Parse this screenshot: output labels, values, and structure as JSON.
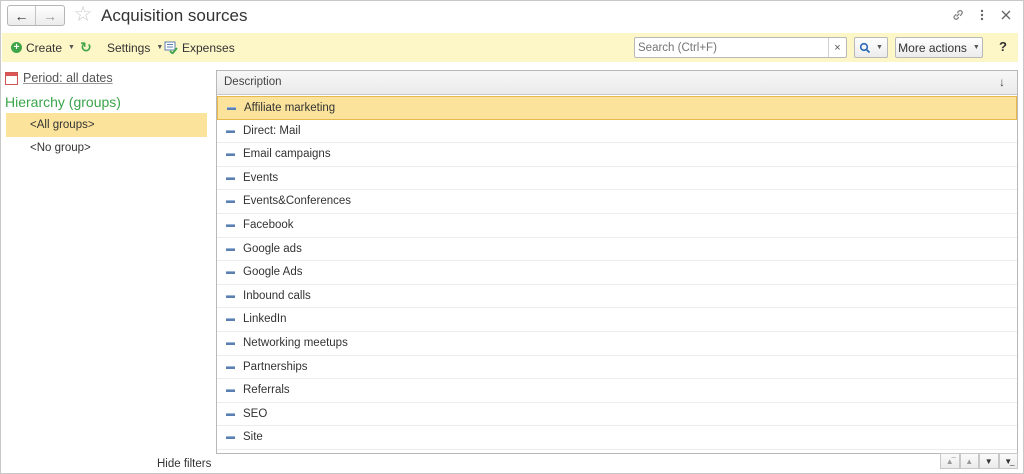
{
  "window": {
    "title": "Acquisition sources"
  },
  "titlebar": {
    "back_icon": "arrow-left-icon",
    "forward_icon": "arrow-right-icon",
    "favorite_icon": "star-icon",
    "link_icon": "link-icon",
    "menu_icon": "kebab-menu-icon",
    "close_icon": "close-icon"
  },
  "toolbar": {
    "create_label": "Create",
    "settings_label": "Settings",
    "expenses_label": "Expenses",
    "search_placeholder": "Search (Ctrl+F)",
    "search_clear": "×",
    "more_actions_label": "More actions",
    "help_label": "?"
  },
  "filters": {
    "period_label": "Period: all dates",
    "hierarchy_title": "Hierarchy (groups)",
    "groups": [
      {
        "label": "<All groups>",
        "selected": true
      },
      {
        "label": "<No group>",
        "selected": false
      }
    ],
    "hide_filters_label": "Hide filters"
  },
  "table": {
    "header": "Description",
    "sort_indicator": "↓",
    "rows": [
      {
        "label": "Affiliate marketing",
        "selected": true
      },
      {
        "label": "Direct: Mail",
        "selected": false
      },
      {
        "label": "Email campaigns",
        "selected": false
      },
      {
        "label": "Events",
        "selected": false
      },
      {
        "label": "Events&Conferences",
        "selected": false
      },
      {
        "label": "Facebook",
        "selected": false
      },
      {
        "label": "Google ads",
        "selected": false
      },
      {
        "label": "Google Ads",
        "selected": false
      },
      {
        "label": "Inbound calls",
        "selected": false
      },
      {
        "label": "LinkedIn",
        "selected": false
      },
      {
        "label": "Networking meetups",
        "selected": false
      },
      {
        "label": "Partnerships",
        "selected": false
      },
      {
        "label": "Referrals",
        "selected": false
      },
      {
        "label": "SEO",
        "selected": false
      },
      {
        "label": "Site",
        "selected": false
      }
    ]
  },
  "colors": {
    "toolbar_bg": "#fdf6c7",
    "selection_bg": "#fbe39b",
    "accent_green": "#3aa54a"
  }
}
